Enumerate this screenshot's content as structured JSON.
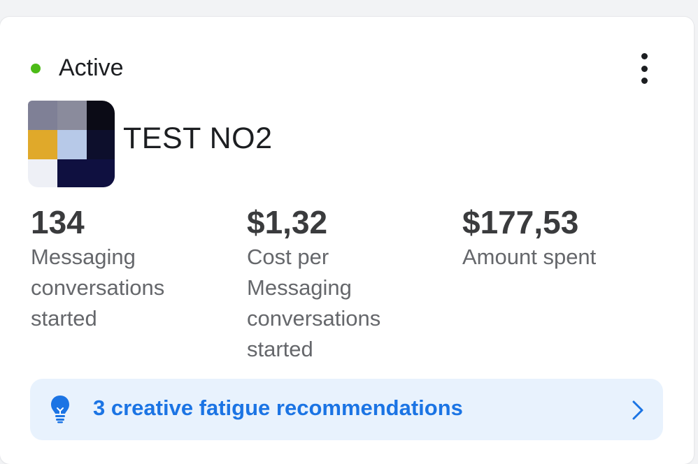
{
  "status": {
    "label": "Active",
    "color": "#4cbb17"
  },
  "ad": {
    "name": "TEST NO2"
  },
  "metrics": [
    {
      "value": "134",
      "label": "Messaging conversations started"
    },
    {
      "value": "$1,32",
      "label": "Cost per Messaging conversations started"
    },
    {
      "value": "$177,53",
      "label": "Amount spent"
    }
  ],
  "recommendation": {
    "text": "3 creative fatigue recommendations",
    "icon": "lightbulb-icon",
    "color": "#1b74e4"
  },
  "icons": {
    "more": "more-vertical-icon",
    "chevron": "chevron-right-icon"
  }
}
